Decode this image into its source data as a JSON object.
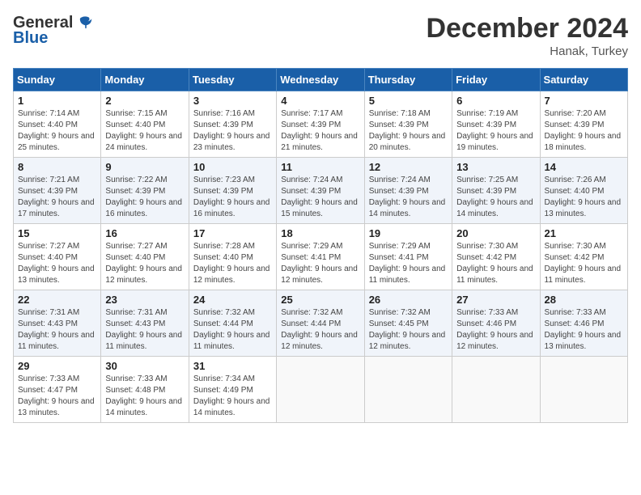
{
  "header": {
    "logo_general": "General",
    "logo_blue": "Blue",
    "month": "December 2024",
    "location": "Hanak, Turkey"
  },
  "weekdays": [
    "Sunday",
    "Monday",
    "Tuesday",
    "Wednesday",
    "Thursday",
    "Friday",
    "Saturday"
  ],
  "weeks": [
    [
      {
        "day": "1",
        "sunrise": "7:14 AM",
        "sunset": "4:40 PM",
        "daylight": "9 hours and 25 minutes."
      },
      {
        "day": "2",
        "sunrise": "7:15 AM",
        "sunset": "4:40 PM",
        "daylight": "9 hours and 24 minutes."
      },
      {
        "day": "3",
        "sunrise": "7:16 AM",
        "sunset": "4:39 PM",
        "daylight": "9 hours and 23 minutes."
      },
      {
        "day": "4",
        "sunrise": "7:17 AM",
        "sunset": "4:39 PM",
        "daylight": "9 hours and 21 minutes."
      },
      {
        "day": "5",
        "sunrise": "7:18 AM",
        "sunset": "4:39 PM",
        "daylight": "9 hours and 20 minutes."
      },
      {
        "day": "6",
        "sunrise": "7:19 AM",
        "sunset": "4:39 PM",
        "daylight": "9 hours and 19 minutes."
      },
      {
        "day": "7",
        "sunrise": "7:20 AM",
        "sunset": "4:39 PM",
        "daylight": "9 hours and 18 minutes."
      }
    ],
    [
      {
        "day": "8",
        "sunrise": "7:21 AM",
        "sunset": "4:39 PM",
        "daylight": "9 hours and 17 minutes."
      },
      {
        "day": "9",
        "sunrise": "7:22 AM",
        "sunset": "4:39 PM",
        "daylight": "9 hours and 16 minutes."
      },
      {
        "day": "10",
        "sunrise": "7:23 AM",
        "sunset": "4:39 PM",
        "daylight": "9 hours and 16 minutes."
      },
      {
        "day": "11",
        "sunrise": "7:24 AM",
        "sunset": "4:39 PM",
        "daylight": "9 hours and 15 minutes."
      },
      {
        "day": "12",
        "sunrise": "7:24 AM",
        "sunset": "4:39 PM",
        "daylight": "9 hours and 14 minutes."
      },
      {
        "day": "13",
        "sunrise": "7:25 AM",
        "sunset": "4:39 PM",
        "daylight": "9 hours and 14 minutes."
      },
      {
        "day": "14",
        "sunrise": "7:26 AM",
        "sunset": "4:40 PM",
        "daylight": "9 hours and 13 minutes."
      }
    ],
    [
      {
        "day": "15",
        "sunrise": "7:27 AM",
        "sunset": "4:40 PM",
        "daylight": "9 hours and 13 minutes."
      },
      {
        "day": "16",
        "sunrise": "7:27 AM",
        "sunset": "4:40 PM",
        "daylight": "9 hours and 12 minutes."
      },
      {
        "day": "17",
        "sunrise": "7:28 AM",
        "sunset": "4:40 PM",
        "daylight": "9 hours and 12 minutes."
      },
      {
        "day": "18",
        "sunrise": "7:29 AM",
        "sunset": "4:41 PM",
        "daylight": "9 hours and 12 minutes."
      },
      {
        "day": "19",
        "sunrise": "7:29 AM",
        "sunset": "4:41 PM",
        "daylight": "9 hours and 11 minutes."
      },
      {
        "day": "20",
        "sunrise": "7:30 AM",
        "sunset": "4:42 PM",
        "daylight": "9 hours and 11 minutes."
      },
      {
        "day": "21",
        "sunrise": "7:30 AM",
        "sunset": "4:42 PM",
        "daylight": "9 hours and 11 minutes."
      }
    ],
    [
      {
        "day": "22",
        "sunrise": "7:31 AM",
        "sunset": "4:43 PM",
        "daylight": "9 hours and 11 minutes."
      },
      {
        "day": "23",
        "sunrise": "7:31 AM",
        "sunset": "4:43 PM",
        "daylight": "9 hours and 11 minutes."
      },
      {
        "day": "24",
        "sunrise": "7:32 AM",
        "sunset": "4:44 PM",
        "daylight": "9 hours and 11 minutes."
      },
      {
        "day": "25",
        "sunrise": "7:32 AM",
        "sunset": "4:44 PM",
        "daylight": "9 hours and 12 minutes."
      },
      {
        "day": "26",
        "sunrise": "7:32 AM",
        "sunset": "4:45 PM",
        "daylight": "9 hours and 12 minutes."
      },
      {
        "day": "27",
        "sunrise": "7:33 AM",
        "sunset": "4:46 PM",
        "daylight": "9 hours and 12 minutes."
      },
      {
        "day": "28",
        "sunrise": "7:33 AM",
        "sunset": "4:46 PM",
        "daylight": "9 hours and 13 minutes."
      }
    ],
    [
      {
        "day": "29",
        "sunrise": "7:33 AM",
        "sunset": "4:47 PM",
        "daylight": "9 hours and 13 minutes."
      },
      {
        "day": "30",
        "sunrise": "7:33 AM",
        "sunset": "4:48 PM",
        "daylight": "9 hours and 14 minutes."
      },
      {
        "day": "31",
        "sunrise": "7:34 AM",
        "sunset": "4:49 PM",
        "daylight": "9 hours and 14 minutes."
      },
      null,
      null,
      null,
      null
    ]
  ]
}
